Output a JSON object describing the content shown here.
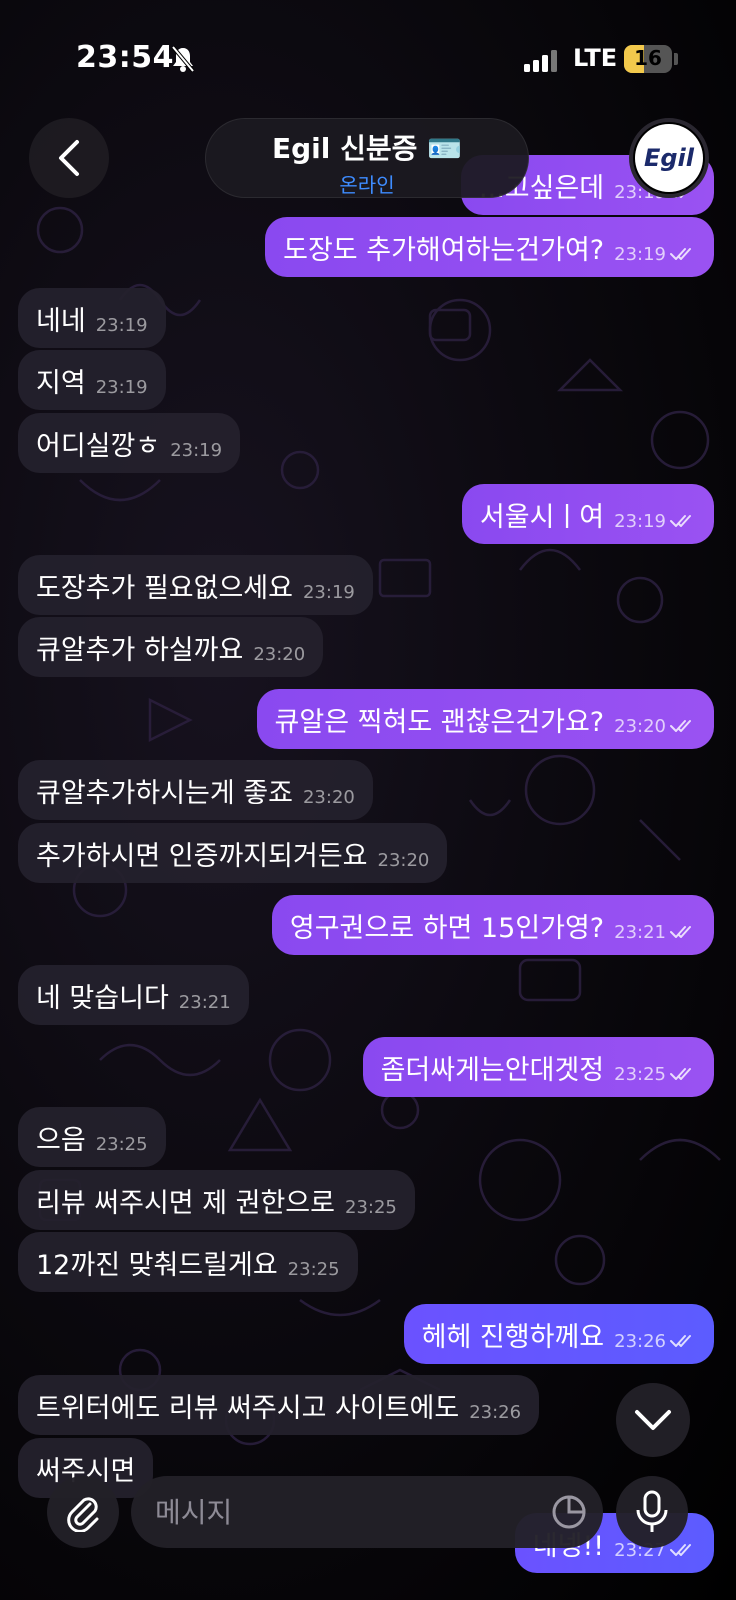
{
  "status_bar": {
    "time": "23:54",
    "network": "LTE",
    "battery": "16",
    "battery_level": 0.16
  },
  "header": {
    "name": "Egil 신분증 🪪",
    "status": "온라인",
    "avatar_text": "Egil"
  },
  "messages": [
    {
      "dir": "out",
      "text": "...고싶은데",
      "time": "23:19"
    },
    {
      "dir": "out",
      "text": "도장도 추가해여하는건가여?",
      "time": "23:19"
    },
    {
      "dir": "in",
      "text": "네네",
      "time": "23:19"
    },
    {
      "dir": "in",
      "text": "지역",
      "time": "23:19"
    },
    {
      "dir": "in",
      "text": "어디실깡ㅎ",
      "time": "23:19"
    },
    {
      "dir": "out",
      "text": "서울시ㅣ여",
      "time": "23:19"
    },
    {
      "dir": "in",
      "text": "도장추가 필요없으세요",
      "time": "23:19"
    },
    {
      "dir": "in",
      "text": "큐알추가 하실까요",
      "time": "23:20"
    },
    {
      "dir": "out",
      "text": "큐알은 찍혀도 괜찮은건가요?",
      "time": "23:20"
    },
    {
      "dir": "in",
      "text": "큐알추가하시는게 좋죠",
      "time": "23:20"
    },
    {
      "dir": "in",
      "text": "추가하시면 인증까지되거든요",
      "time": "23:20"
    },
    {
      "dir": "out",
      "text": "영구권으로 하면 15인가영?",
      "time": "23:21"
    },
    {
      "dir": "in",
      "text": "네 맞습니다",
      "time": "23:21"
    },
    {
      "dir": "out",
      "text": "좀더싸게는안대겟정",
      "time": "23:25"
    },
    {
      "dir": "in",
      "text": "으음",
      "time": "23:25"
    },
    {
      "dir": "in",
      "text": "리뷰 써주시면 제 권한으로",
      "time": "23:25"
    },
    {
      "dir": "in",
      "text": "12까진 맞춰드릴게요",
      "time": "23:25"
    },
    {
      "dir": "out",
      "text": "헤헤 진행하께요",
      "time": "23:26"
    },
    {
      "dir": "in",
      "text": "트위터에도 리뷰 써주시고 사이트에도",
      "time": "23:26"
    },
    {
      "dir": "in",
      "text": "써주시면",
      "time": ""
    },
    {
      "dir": "out",
      "text": "네넹!!",
      "time": "23:27"
    }
  ],
  "composer": {
    "placeholder": "메시지"
  },
  "icons": {
    "back": "chevron-left-icon",
    "scroll_down": "chevron-down-icon",
    "attach": "paperclip-icon",
    "sticker": "sticker-icon",
    "mic": "microphone-icon",
    "silent": "bell-slash-icon"
  },
  "colors": {
    "outgoing_bubble": "#9a52f2",
    "outgoing_bubble_latest": "#5c5cff",
    "incoming_bubble": "#24212c",
    "status_online": "#3e8cff",
    "battery": "#f2c94c"
  }
}
